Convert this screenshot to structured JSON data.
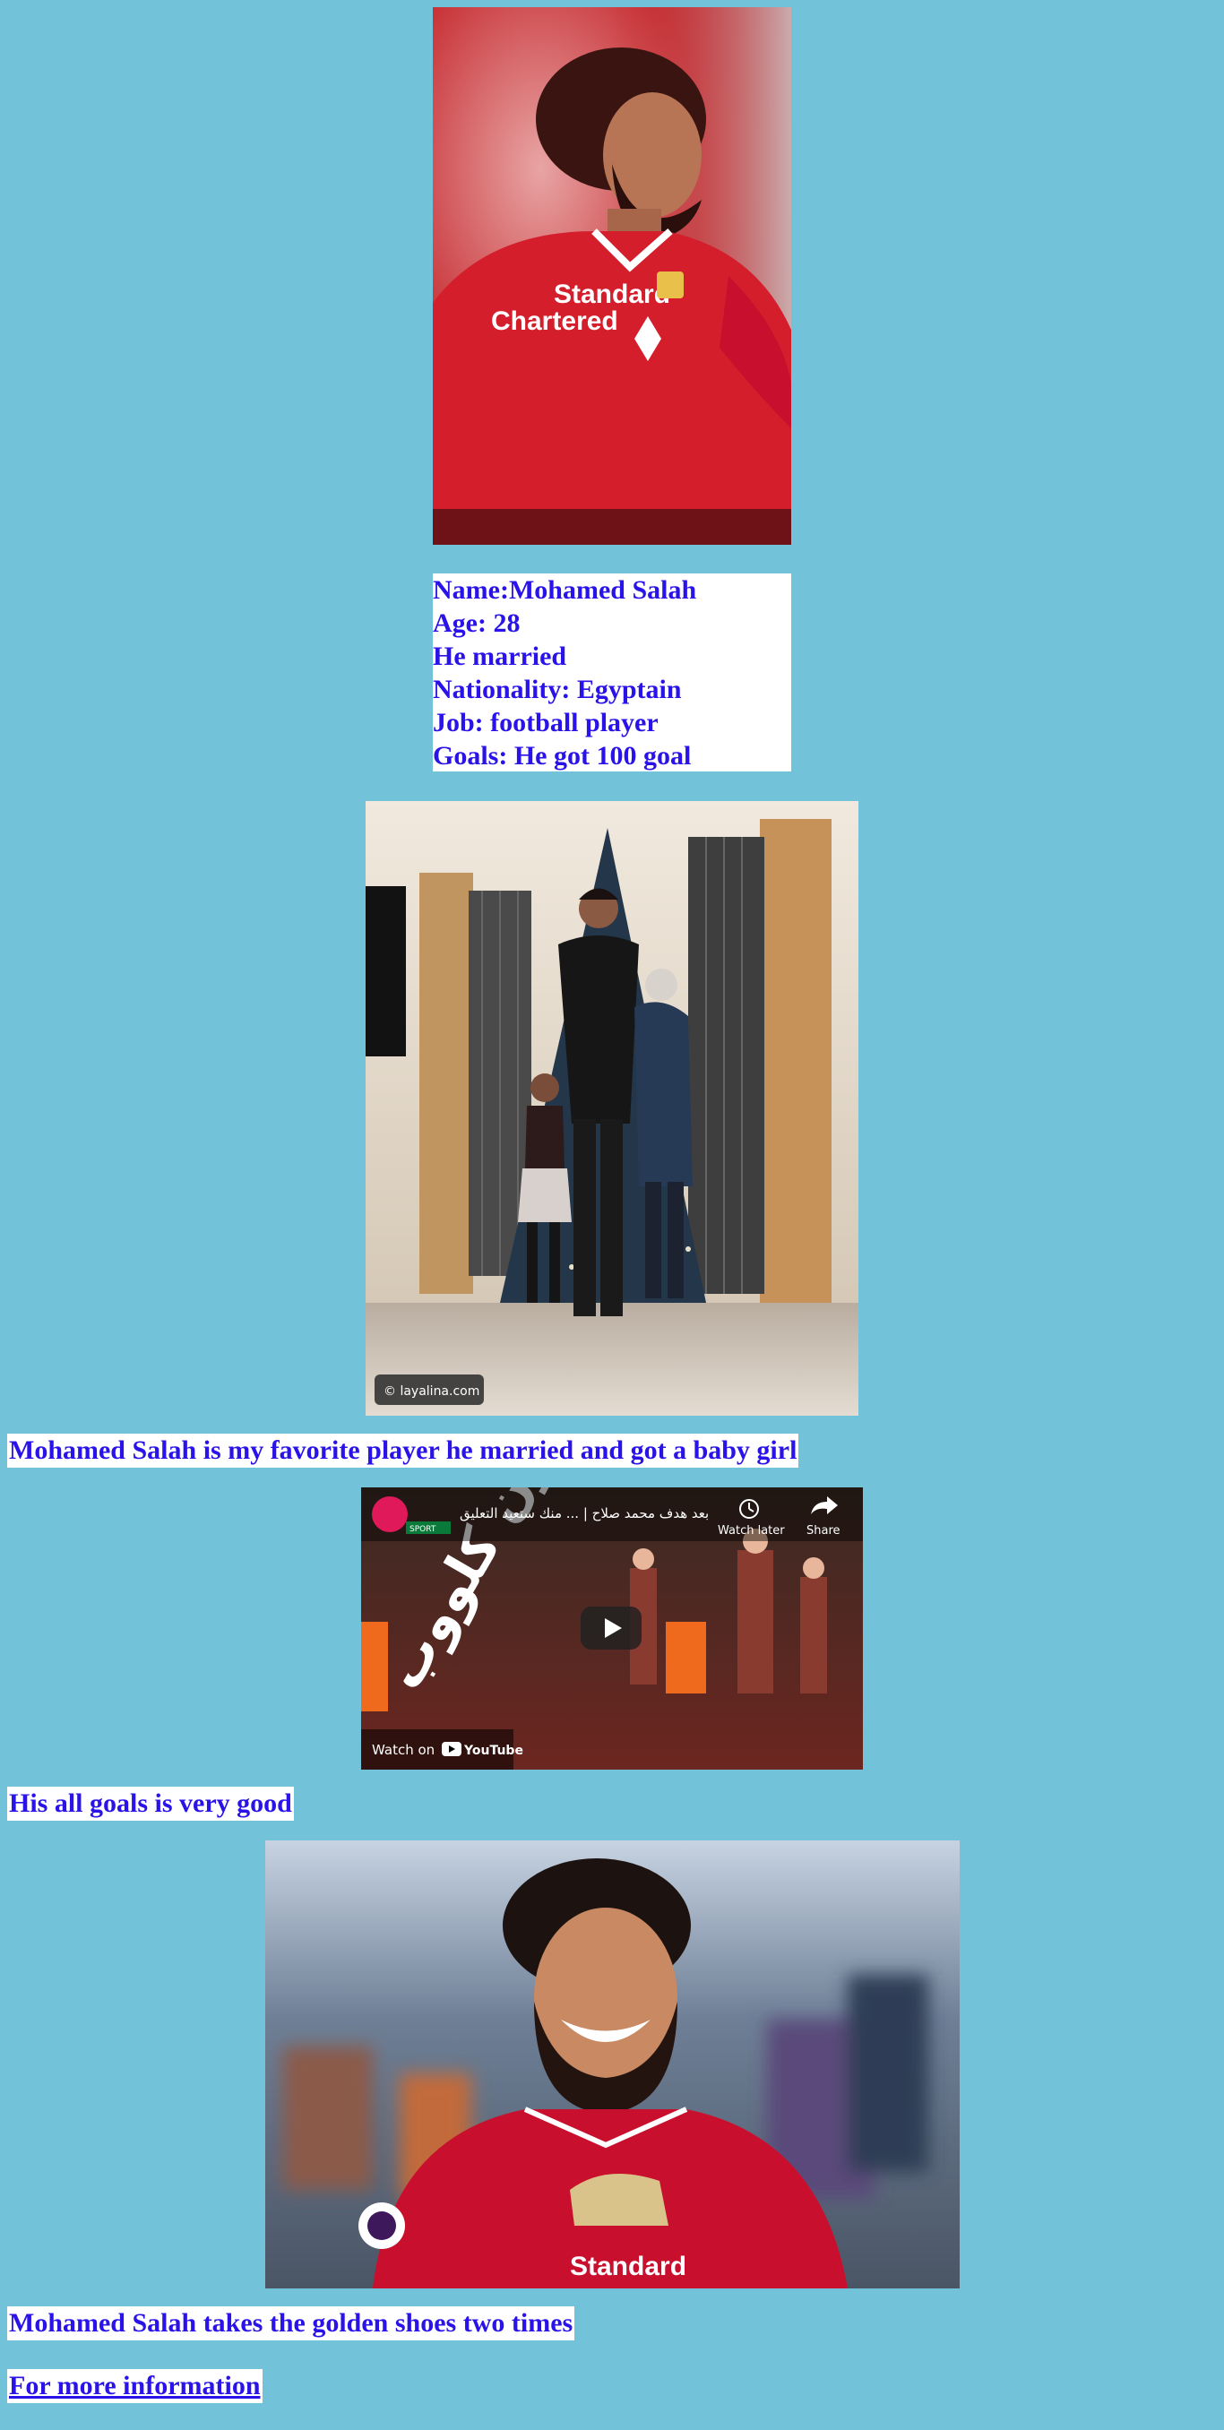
{
  "profile": {
    "name_line": "Name:Mohamed Salah",
    "age_line": "Age: 28",
    "married_line": "He married",
    "nationality_line": "Nationality: Egyptain",
    "job_line": "Job: football player",
    "goals_line": "Goals: He got 100 goal"
  },
  "hero_image": {
    "sponsor_line1": "Standard",
    "sponsor_line2": "Chartered"
  },
  "family_image": {
    "watermark": "© layalina.com"
  },
  "captions": {
    "family": "Mohamed Salah is my favorite player he married and got a baby girl",
    "goals": "His all goals is very good",
    "shoes": "Mohamed Salah takes the golden shoes two times"
  },
  "video": {
    "title": "بعد هدف محمد صلاح | ... منك ستعيد التعليق",
    "watch_later": "Watch later",
    "share": "Share",
    "watch_on": "Watch on",
    "youtube": "YouTube",
    "overlay_text": "جلووون كلووب",
    "channel_badge": "SPORT"
  },
  "smile_image": {
    "shirt_text": "Standard"
  },
  "link": {
    "label": "For more information"
  },
  "colors": {
    "page_background": "#72c2d9",
    "text_blue": "#2a13e8",
    "liverpool_red": "#c8102e"
  }
}
